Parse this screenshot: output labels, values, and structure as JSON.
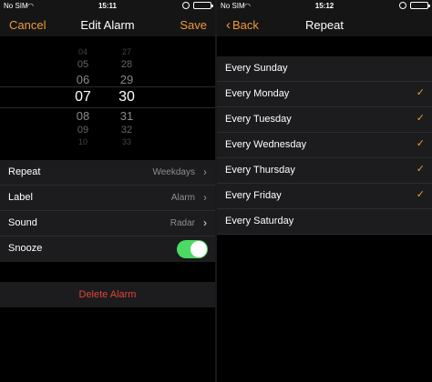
{
  "left": {
    "status": {
      "carrier": "No SIM",
      "time": "15:11"
    },
    "nav": {
      "cancel": "Cancel",
      "title": "Edit Alarm",
      "save": "Save"
    },
    "picker": {
      "hours": [
        "04",
        "05",
        "06",
        "07",
        "08",
        "09",
        "10"
      ],
      "minutes": [
        "27",
        "28",
        "29",
        "30",
        "31",
        "32",
        "33"
      ],
      "selected_hour": "07",
      "selected_minute": "30"
    },
    "settings": [
      {
        "label": "Repeat",
        "value": "Weekdays"
      },
      {
        "label": "Label",
        "value": "Alarm"
      },
      {
        "label": "Sound",
        "value": "Radar"
      },
      {
        "label": "Snooze",
        "toggle": true
      }
    ],
    "delete_label": "Delete Alarm"
  },
  "right": {
    "status": {
      "carrier": "No SIM",
      "time": "15:12"
    },
    "nav": {
      "back": "Back",
      "title": "Repeat"
    },
    "days": [
      {
        "label": "Every Sunday",
        "checked": false
      },
      {
        "label": "Every Monday",
        "checked": true
      },
      {
        "label": "Every Tuesday",
        "checked": true
      },
      {
        "label": "Every Wednesday",
        "checked": true
      },
      {
        "label": "Every Thursday",
        "checked": true
      },
      {
        "label": "Every Friday",
        "checked": true
      },
      {
        "label": "Every Saturday",
        "checked": false
      }
    ]
  },
  "colors": {
    "accent": "#f09a37",
    "destructive": "#e0423a",
    "toggle_on": "#4cd964"
  },
  "icons": {
    "wifi": "wifi-icon",
    "alarm": "alarm-clock-icon",
    "battery": "battery-icon",
    "chevron": "chevron-right-icon",
    "check": "checkmark-icon",
    "back": "chevron-left-icon"
  }
}
